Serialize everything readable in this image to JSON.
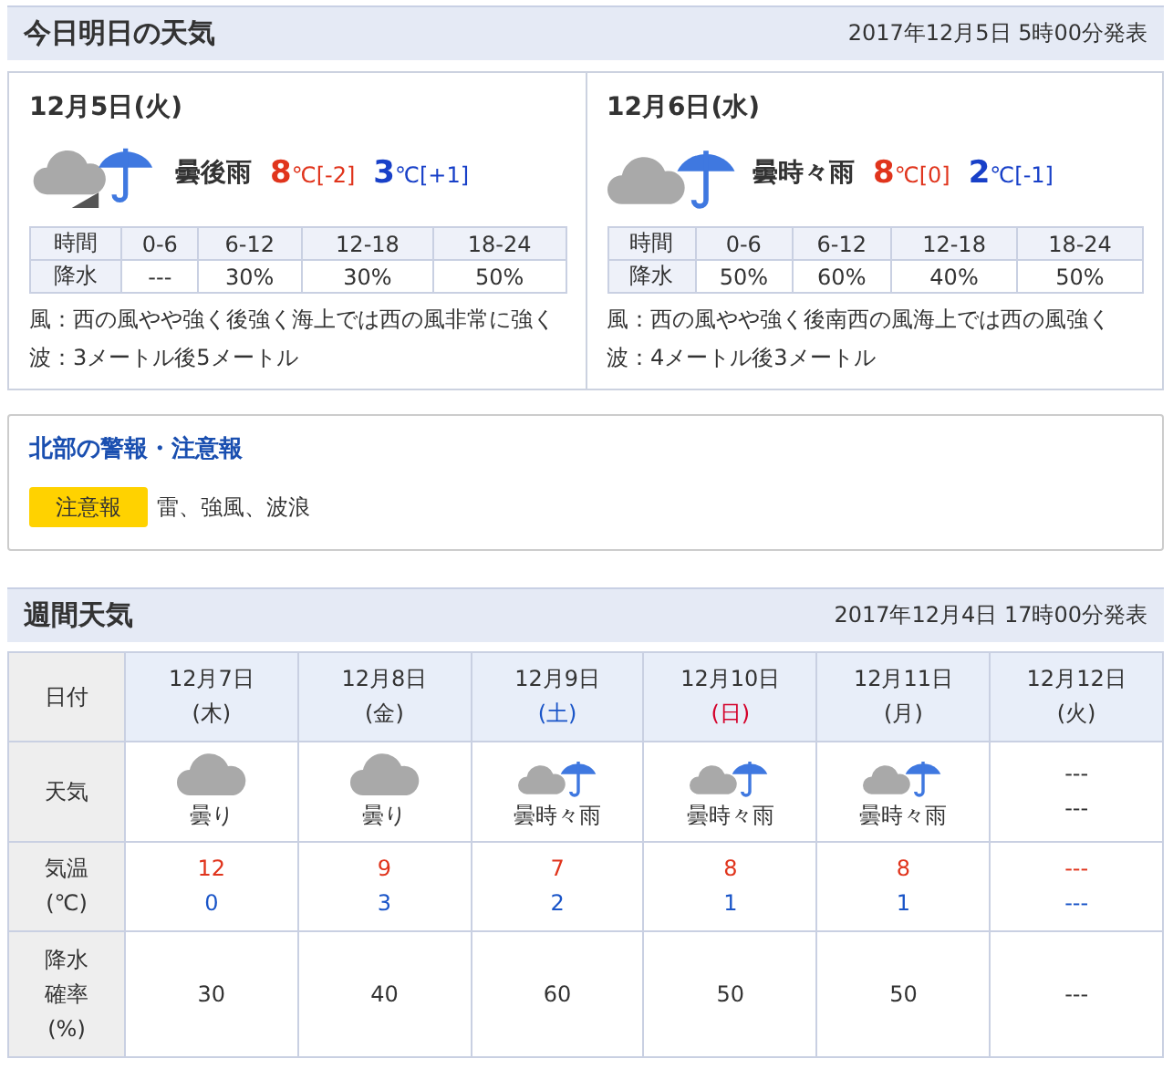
{
  "today_section": {
    "title": "今日明日の天気",
    "issued": "2017年12月5日 5時00分発表",
    "days": [
      {
        "date": "12月5日(火)",
        "icon": {
          "kind": "cloudy-then-rain"
        },
        "weather": "曇後雨",
        "high": {
          "value": "8",
          "unit": "℃",
          "diff": "[-2]"
        },
        "low": {
          "value": "3",
          "unit": "℃",
          "diff": "[+1]"
        },
        "table_header": [
          "時間",
          "0-6",
          "6-12",
          "12-18",
          "18-24"
        ],
        "table_row": [
          "降水",
          "---",
          "30%",
          "30%",
          "50%"
        ],
        "wind": "風：西の風やや強く後強く海上では西の風非常に強く",
        "wave": "波：3メートル後5メートル"
      },
      {
        "date": "12月6日(水)",
        "icon": {
          "kind": "cloudy-occasional-rain"
        },
        "weather": "曇時々雨",
        "high": {
          "value": "8",
          "unit": "℃",
          "diff": "[0]"
        },
        "low": {
          "value": "2",
          "unit": "℃",
          "diff": "[-1]"
        },
        "table_header": [
          "時間",
          "0-6",
          "6-12",
          "12-18",
          "18-24"
        ],
        "table_row": [
          "降水",
          "50%",
          "60%",
          "40%",
          "50%"
        ],
        "wind": "風：西の風やや強く後南西の風海上では西の風強く",
        "wave": "波：4メートル後3メートル"
      }
    ]
  },
  "warnings": {
    "title": "北部の警報・注意報",
    "items": [
      {
        "label": "注意報",
        "text": "雷、強風、波浪"
      }
    ]
  },
  "weekly": {
    "title": "週間天気",
    "issued": "2017年12月4日 17時00分発表",
    "row_labels": {
      "date": "日付",
      "weather": "天気",
      "temp": [
        "気温",
        "(℃)"
      ],
      "precip": [
        "降水",
        "確率",
        "(%)"
      ]
    },
    "days": [
      {
        "date": "12月7日",
        "weekday": {
          "text": "(木)",
          "color": "#333333"
        },
        "icon": {
          "kind": "cloudy"
        },
        "weather": "曇り",
        "high": "12",
        "low": "0",
        "precip": "30"
      },
      {
        "date": "12月8日",
        "weekday": {
          "text": "(金)",
          "color": "#333333"
        },
        "icon": {
          "kind": "cloudy"
        },
        "weather": "曇り",
        "high": "9",
        "low": "3",
        "precip": "40"
      },
      {
        "date": "12月9日",
        "weekday": {
          "text": "(土)",
          "color": "#1a55c8"
        },
        "icon": {
          "kind": "cloudy-occasional-rain"
        },
        "weather": "曇時々雨",
        "high": "7",
        "low": "2",
        "precip": "60"
      },
      {
        "date": "12月10日",
        "weekday": {
          "text": "(日)",
          "color": "#d4002a"
        },
        "icon": {
          "kind": "cloudy-occasional-rain"
        },
        "weather": "曇時々雨",
        "high": "8",
        "low": "1",
        "precip": "50"
      },
      {
        "date": "12月11日",
        "weekday": {
          "text": "(月)",
          "color": "#333333"
        },
        "icon": {
          "kind": "cloudy-occasional-rain"
        },
        "weather": "曇時々雨",
        "high": "8",
        "low": "1",
        "precip": "50"
      },
      {
        "date": "12月12日",
        "weekday": {
          "text": "(火)",
          "color": "#333333"
        },
        "weather": "---",
        "weather_line": "---",
        "high": "---",
        "low": "---",
        "precip": "---"
      }
    ]
  }
}
